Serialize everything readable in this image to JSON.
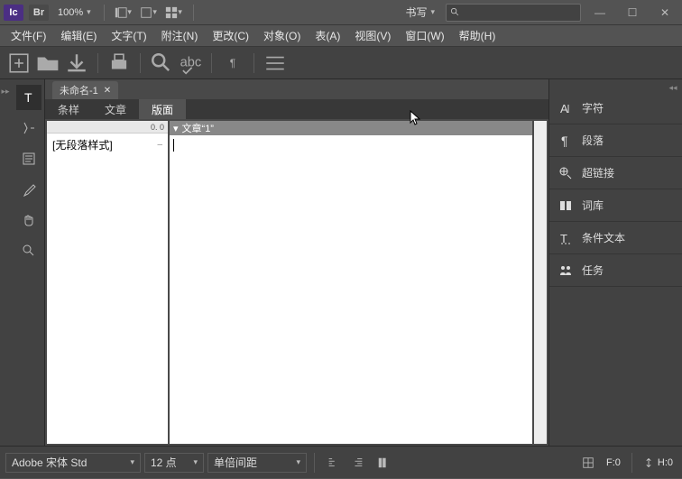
{
  "titlebar": {
    "app_abbr": "Ic",
    "bridge_abbr": "Br",
    "zoom": "100%",
    "workspace": "书写",
    "search_placeholder": ""
  },
  "menu": {
    "file": "文件(F)",
    "edit": "编辑(E)",
    "text": "文字(T)",
    "notes": "附注(N)",
    "change": "更改(C)",
    "object": "对象(O)",
    "table": "表(A)",
    "view": "视图(V)",
    "window": "窗口(W)",
    "help": "帮助(H)"
  },
  "document": {
    "tab_name": "未命名-1",
    "panel_tabs": {
      "styles": "条样",
      "story": "文章",
      "layout": "版面"
    },
    "style_header_val": "0. 0",
    "style_item": "[无段落样式]",
    "content_title": "文章“1”"
  },
  "right_panels": {
    "character": "字符",
    "paragraph": "段落",
    "hyperlinks": "超链接",
    "thesaurus": "词库",
    "conditional": "条件文本",
    "assignments": "任务"
  },
  "statusbar": {
    "font": "Adobe 宋体 Std",
    "size": "12 点",
    "spacing": "单倍间距",
    "frame_label": "F:0",
    "height_label": "H:0"
  }
}
